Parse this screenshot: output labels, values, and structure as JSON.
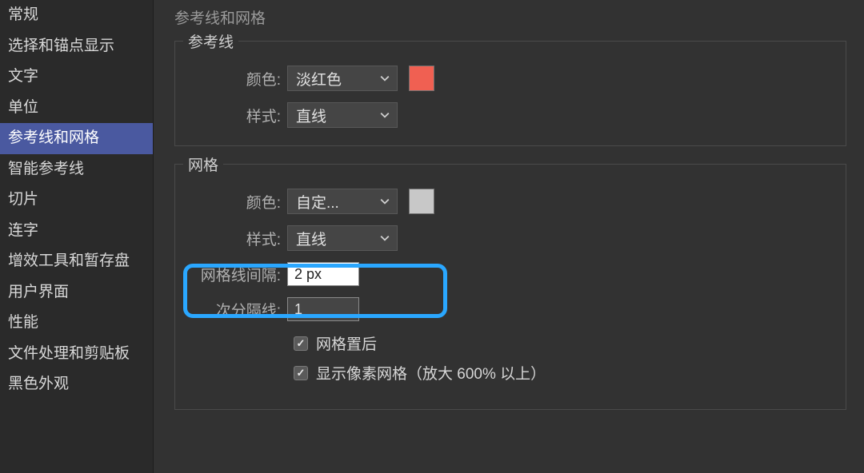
{
  "sidebar": {
    "items": [
      {
        "label": "常规",
        "selected": false
      },
      {
        "label": "选择和锚点显示",
        "selected": false
      },
      {
        "label": "文字",
        "selected": false
      },
      {
        "label": "单位",
        "selected": false
      },
      {
        "label": "参考线和网格",
        "selected": true
      },
      {
        "label": "智能参考线",
        "selected": false
      },
      {
        "label": "切片",
        "selected": false
      },
      {
        "label": "连字",
        "selected": false
      },
      {
        "label": "增效工具和暂存盘",
        "selected": false
      },
      {
        "label": "用户界面",
        "selected": false
      },
      {
        "label": "性能",
        "selected": false
      },
      {
        "label": "文件处理和剪贴板",
        "selected": false
      },
      {
        "label": "黑色外观",
        "selected": false
      }
    ]
  },
  "page": {
    "title": "参考线和网格"
  },
  "guides": {
    "title": "参考线",
    "color_label": "颜色:",
    "color_value": "淡红色",
    "style_label": "样式:",
    "style_value": "直线",
    "swatch_color": "#f06052"
  },
  "grid": {
    "title": "网格",
    "color_label": "颜色:",
    "color_value": "自定...",
    "style_label": "样式:",
    "style_value": "直线",
    "gridline_label": "网格线间隔:",
    "gridline_value": "2 px",
    "subdivision_label": "次分隔线:",
    "subdivision_value": "1",
    "behind_label": "网格置后",
    "behind_checked": true,
    "pixel_label": "显示像素网格（放大 600% 以上）",
    "pixel_checked": true,
    "swatch_color": "#c8c8c8"
  }
}
